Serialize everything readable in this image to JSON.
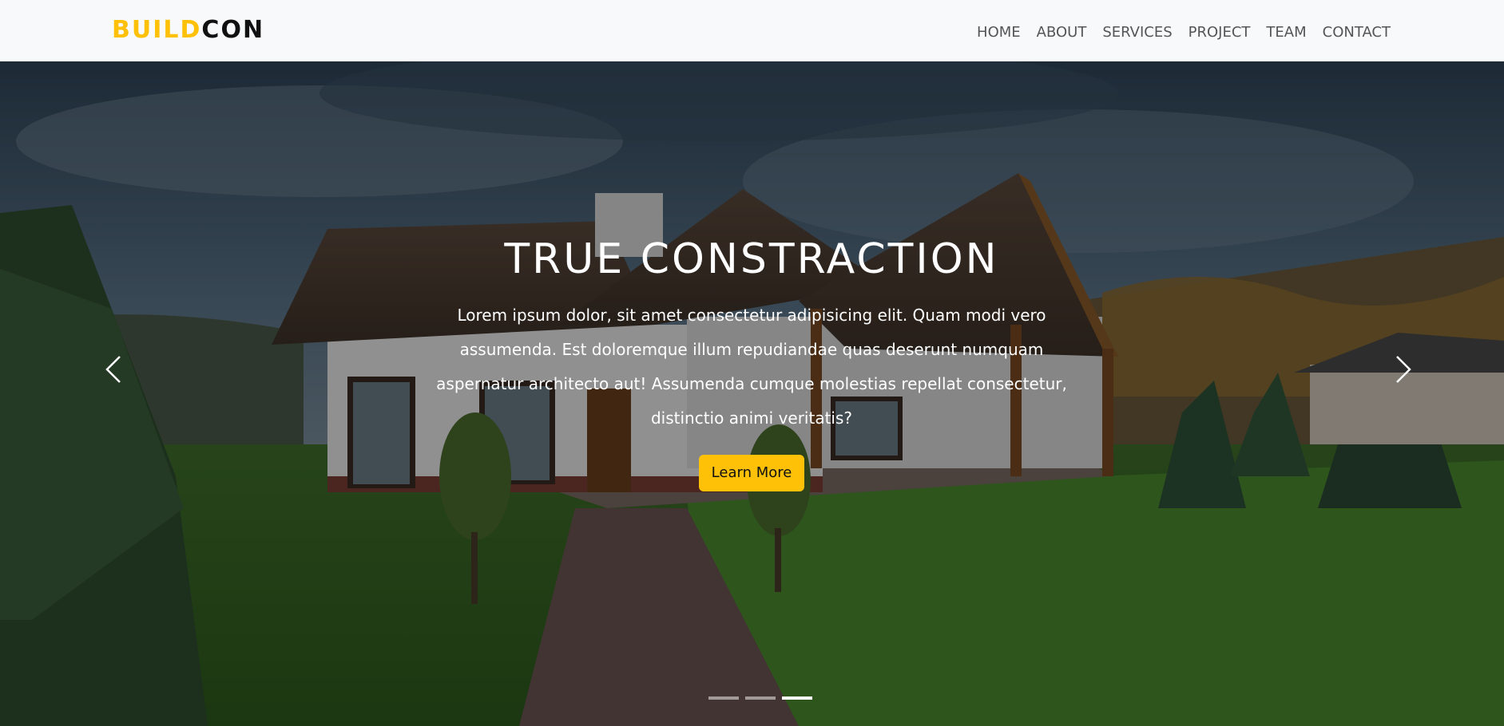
{
  "brand": {
    "part1": "BUILD",
    "part2": "CON",
    "color_accent": "#ffc107"
  },
  "nav": {
    "items": [
      "HOME",
      "ABOUT",
      "SERVICES",
      "PROJECT",
      "TEAM",
      "CONTACT"
    ]
  },
  "hero": {
    "title": "TRUE CONSTRACTION",
    "description": "Lorem ipsum dolor, sit amet consectetur adipisicing elit. Quam modi vero assumenda. Est doloremque illum repudiandae quas deserunt numquam aspernatur architecto aut! Assumenda cumque molestias repellat consectetur, distinctio animi veritatis?",
    "button_label": "Learn More",
    "prev_icon": "chevron-left-icon",
    "next_icon": "chevron-right-icon",
    "slides_total": 3,
    "active_slide": 3
  }
}
